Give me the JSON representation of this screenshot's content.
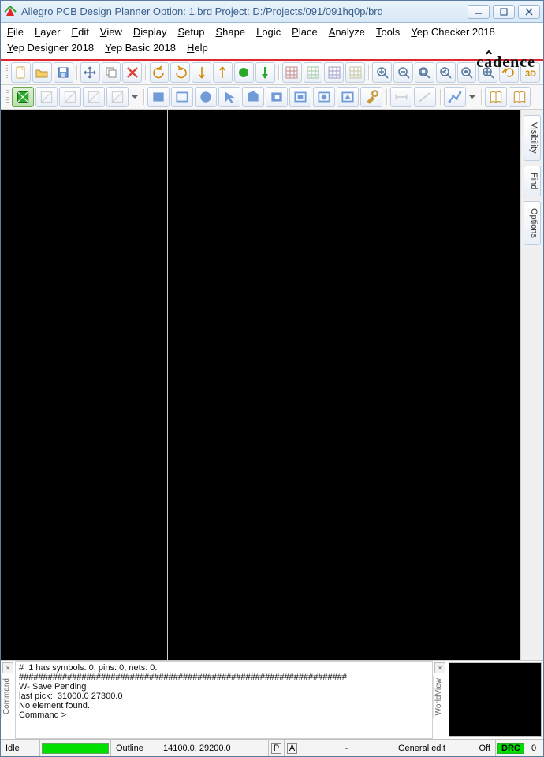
{
  "window": {
    "title": "Allegro PCB Design Planner Option: 1.brd  Project: D:/Projects/091/091hq0p/brd"
  },
  "menu": {
    "row1": [
      "File",
      "Layer",
      "Edit",
      "View",
      "Display",
      "Setup",
      "Shape",
      "Logic",
      "Place",
      "Analyze",
      "Tools",
      "Yep Checker 2018"
    ],
    "row2": [
      "Yep Designer 2018",
      "Yep Basic 2018",
      "Help"
    ]
  },
  "brand": "cādence",
  "toolbar1": [
    {
      "name": "new-file-icon",
      "type": "new"
    },
    {
      "name": "open-file-icon",
      "type": "open"
    },
    {
      "name": "save-file-icon",
      "type": "save"
    },
    {
      "sep": true
    },
    {
      "name": "move-icon",
      "type": "move"
    },
    {
      "name": "copy-icon",
      "type": "copy"
    },
    {
      "name": "delete-icon",
      "type": "delete",
      "color": "#d9463a"
    },
    {
      "sep": true
    },
    {
      "name": "undo-icon",
      "type": "undo",
      "color": "#d28a00"
    },
    {
      "name": "redo-icon",
      "type": "redo",
      "color": "#d28a00"
    },
    {
      "name": "mirror-v-icon",
      "type": "mirrv",
      "color": "#d28a00"
    },
    {
      "name": "mirror-h-icon",
      "type": "mirrh",
      "color": "#d28a00"
    },
    {
      "name": "drc-run-icon",
      "type": "circle-fill",
      "color": "#2aa82a"
    },
    {
      "name": "pin-icon",
      "type": "pin",
      "color": "#2aa82a"
    },
    {
      "sep": true
    },
    {
      "name": "grid-a-icon",
      "type": "grid",
      "color": "#c78b8b"
    },
    {
      "name": "grid-b-icon",
      "type": "grid",
      "color": "#9fc79f"
    },
    {
      "name": "grid-c-icon",
      "type": "grid",
      "color": "#9f9fc7"
    },
    {
      "name": "grid-d-icon",
      "type": "grid",
      "color": "#c7c79f"
    },
    {
      "sep": true
    },
    {
      "name": "zoom-in-icon",
      "type": "zoomin"
    },
    {
      "name": "zoom-out-icon",
      "type": "zoomout"
    },
    {
      "name": "zoom-fit-icon",
      "type": "zoomfit"
    },
    {
      "name": "zoom-prev-icon",
      "type": "zoomprev"
    },
    {
      "name": "zoom-sel-icon",
      "type": "zoomsel"
    },
    {
      "name": "zoom-world-icon",
      "type": "zoomworld"
    },
    {
      "name": "refresh-icon",
      "type": "refresh",
      "color": "#d28a00"
    },
    {
      "name": "view-3d-icon",
      "type": "threeD",
      "color": "#d28a00"
    }
  ],
  "toolbar2": [
    {
      "name": "layer-active-icon",
      "type": "layersq",
      "active": true,
      "color": "#2aa82a"
    },
    {
      "name": "layer-2-icon",
      "type": "layersq-line",
      "muted": true
    },
    {
      "name": "layer-3-icon",
      "type": "layersq-line",
      "muted": true
    },
    {
      "name": "layer-4-icon",
      "type": "layersq-line",
      "muted": true
    },
    {
      "name": "layer-5-icon",
      "type": "layersq-line",
      "muted": true
    },
    {
      "drop": true
    },
    {
      "sep": true
    },
    {
      "name": "shape-rect-fill-icon",
      "type": "rect-fill",
      "color": "#6f9bd8"
    },
    {
      "name": "shape-rect-icon",
      "type": "rect",
      "color": "#6f9bd8"
    },
    {
      "name": "shape-circle-icon",
      "type": "circle-fill",
      "color": "#6f9bd8"
    },
    {
      "name": "select-icon",
      "type": "cursor",
      "color": "#6f9bd8"
    },
    {
      "name": "shape-poly-icon",
      "type": "poly",
      "color": "#6f9bd8"
    },
    {
      "name": "shape-cut-icon",
      "type": "cut",
      "color": "#6f9bd8"
    },
    {
      "name": "void-rect-icon",
      "type": "void",
      "color": "#6f9bd8"
    },
    {
      "name": "void-circle-icon",
      "type": "void-circle",
      "color": "#6f9bd8"
    },
    {
      "name": "void-poly-icon",
      "type": "void-poly",
      "color": "#6f9bd8"
    },
    {
      "name": "shape-tool-icon",
      "type": "tool",
      "color": "#c99a3a"
    },
    {
      "sep": true
    },
    {
      "name": "dim-a-icon",
      "type": "dim",
      "muted": true
    },
    {
      "name": "dim-b-icon",
      "type": "dim-line",
      "muted": true
    },
    {
      "sep": true
    },
    {
      "name": "graph-icon",
      "type": "graph",
      "color": "#6f9bd8"
    },
    {
      "drop": true
    },
    {
      "sep": true
    },
    {
      "name": "book-a-icon",
      "type": "book",
      "color": "#c99a3a"
    },
    {
      "name": "book-b-icon",
      "type": "book",
      "color": "#c99a3a"
    }
  ],
  "side_tabs": [
    "Visibility",
    "Find",
    "Options"
  ],
  "console": {
    "label": "Command",
    "lines": [
      "#  1 has symbols: 0, pins: 0, nets: 0.",
      "####################################################################",
      "W- Save Pending",
      "last pick:  31000.0 27300.0",
      "No element found.",
      "Command >"
    ]
  },
  "worldview_label": "WorldView",
  "status": {
    "state": "Idle",
    "layer": "Outline",
    "coords": "14100.0, 29200.0",
    "flag_p": "P",
    "flag_a": "A",
    "dash": "-",
    "mode": "General edit",
    "snap": "Off",
    "drc": "DRC",
    "drc_count": "0"
  }
}
